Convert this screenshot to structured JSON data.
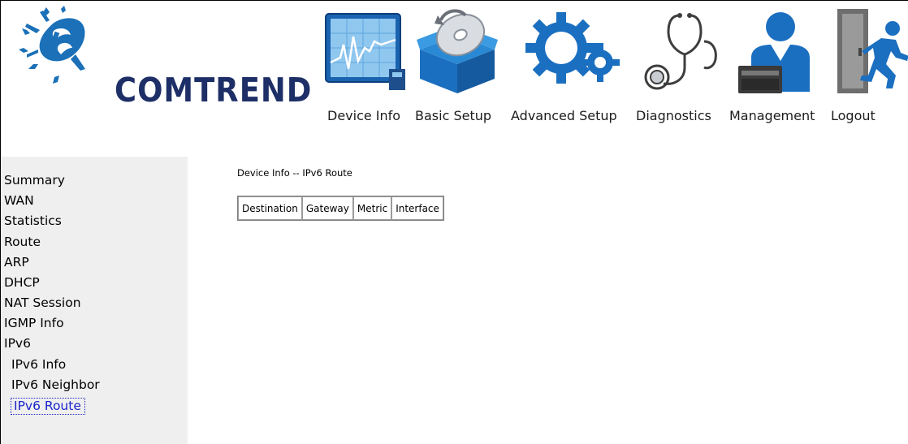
{
  "brand": {
    "name": "COMTREND"
  },
  "nav": [
    {
      "label": "Device Info",
      "icon": "device-info-icon"
    },
    {
      "label": "Basic Setup",
      "icon": "basic-setup-icon"
    },
    {
      "label": "Advanced Setup",
      "icon": "advanced-setup-icon"
    },
    {
      "label": "Diagnostics",
      "icon": "diagnostics-icon"
    },
    {
      "label": "Management",
      "icon": "management-icon"
    },
    {
      "label": "Logout",
      "icon": "logout-icon"
    }
  ],
  "sidebar": {
    "items": [
      {
        "label": "Summary"
      },
      {
        "label": "WAN"
      },
      {
        "label": "Statistics"
      },
      {
        "label": "Route"
      },
      {
        "label": "ARP"
      },
      {
        "label": "DHCP"
      },
      {
        "label": "NAT Session"
      },
      {
        "label": "IGMP Info"
      },
      {
        "label": "IPv6"
      },
      {
        "label": "IPv6 Info"
      },
      {
        "label": "IPv6 Neighbor"
      },
      {
        "label": "IPv6 Route",
        "active": true
      }
    ]
  },
  "main": {
    "title": "Device Info -- IPv6 Route",
    "table": {
      "headers": [
        "Destination",
        "Gateway",
        "Metric",
        "Interface"
      ],
      "rows": []
    }
  },
  "colors": {
    "sidebar_bg": "#efefef",
    "active_link": "#1a25c9",
    "brand_text": "#1d2f66",
    "icon_blue": "#1b6fc0"
  }
}
